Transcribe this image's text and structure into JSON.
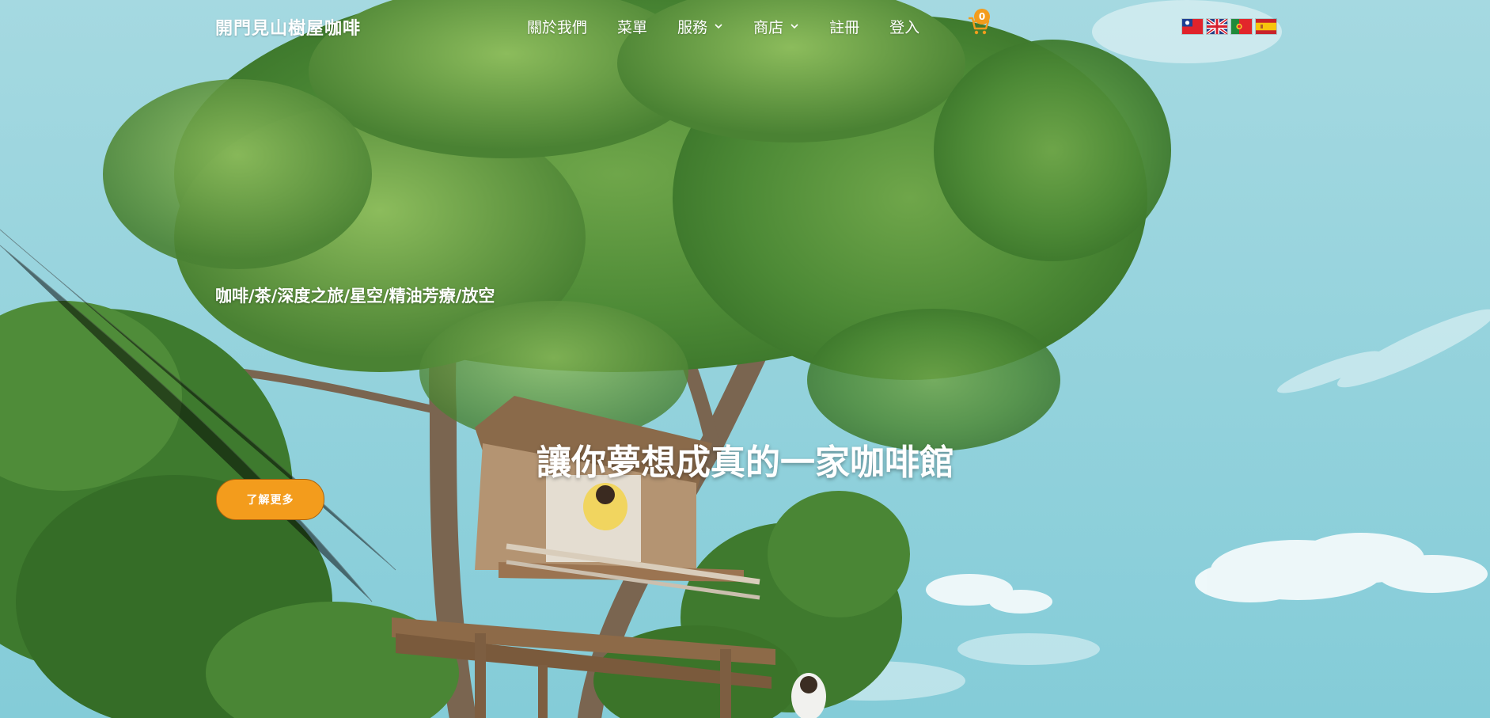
{
  "header": {
    "brand": "開門見山樹屋咖啡",
    "nav": [
      {
        "label": "關於我們"
      },
      {
        "label": "菜單"
      },
      {
        "label": "服務"
      },
      {
        "label": "商店"
      },
      {
        "label": "註冊"
      },
      {
        "label": "登入"
      }
    ],
    "cart_count": "0",
    "cart_icon": "cart-icon",
    "languages": [
      "zh-TW flag",
      "en flag",
      "pt flag",
      "es flag"
    ]
  },
  "hero": {
    "subtitle": "咖啡/茶/深度之旅/星空/精油芳療/放空",
    "headline": "讓你夢想成真的一家咖啡館",
    "cta_label": "了解更多"
  },
  "colors": {
    "accent": "#f39c1c",
    "sky": "#86cfdb",
    "text": "#ffffff"
  }
}
